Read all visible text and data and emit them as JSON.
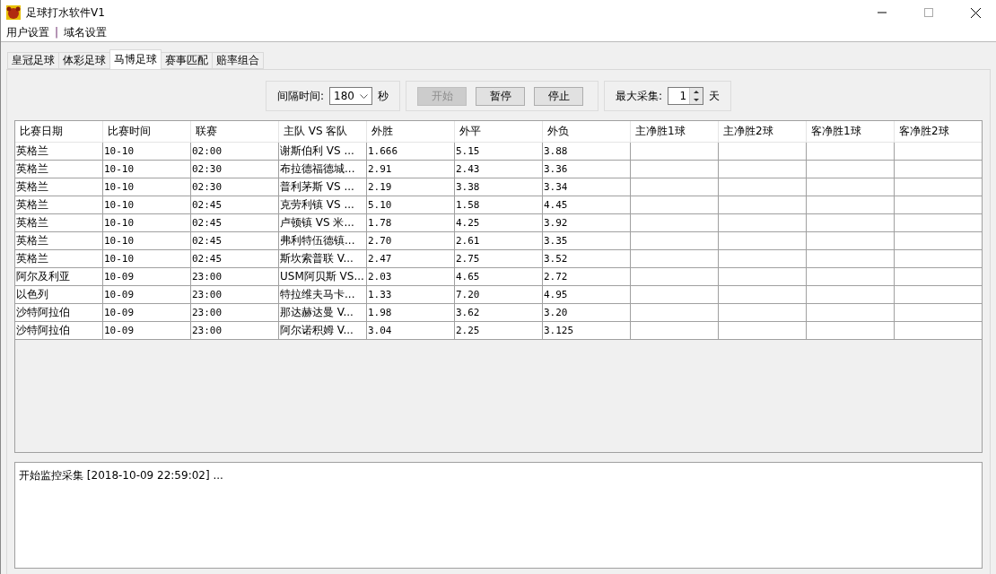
{
  "window": {
    "title": "足球打水软件V1"
  },
  "menu": [
    {
      "label": "用户设置"
    },
    {
      "label": "|",
      "kind": "separator"
    },
    {
      "label": "域名设置"
    }
  ],
  "tabs": [
    {
      "label": "皇冠足球",
      "selected": false
    },
    {
      "label": "体彩足球",
      "selected": false
    },
    {
      "label": "马博足球",
      "selected": true
    },
    {
      "label": "赛事匹配",
      "selected": false
    },
    {
      "label": "赔率组合",
      "selected": false
    }
  ],
  "interval": {
    "label": "间隔时间:",
    "value": "180",
    "unit": "秒"
  },
  "buttons": [
    {
      "label": "开始",
      "disabled": true
    },
    {
      "label": "暂停",
      "disabled": false
    },
    {
      "label": "停止",
      "disabled": false
    }
  ],
  "max_collect": {
    "label": "最大采集:",
    "value": "1",
    "unit": "天"
  },
  "table": {
    "columns": [
      "比赛日期",
      "比赛时间",
      "联赛",
      "主队 VS 客队",
      "外胜",
      "外平",
      "外负",
      "主净胜1球",
      "主净胜2球",
      "客净胜1球",
      "客净胜2球"
    ],
    "rows": [
      [
        "英格兰",
        "10-10",
        "02:00",
        "谢斯伯利 VS ...",
        "1.666",
        "5.15",
        "3.88",
        "",
        "",
        "",
        ""
      ],
      [
        "英格兰",
        "10-10",
        "02:30",
        "布拉德福德城...",
        "2.91",
        "2.43",
        "3.36",
        "",
        "",
        "",
        ""
      ],
      [
        "英格兰",
        "10-10",
        "02:30",
        "普利茅斯 VS ...",
        "2.19",
        "3.38",
        "3.34",
        "",
        "",
        "",
        ""
      ],
      [
        "英格兰",
        "10-10",
        "02:45",
        "克劳利镇 VS ...",
        "5.10",
        "1.58",
        "4.45",
        "",
        "",
        "",
        ""
      ],
      [
        "英格兰",
        "10-10",
        "02:45",
        "卢顿镇 VS 米...",
        "1.78",
        "4.25",
        "3.92",
        "",
        "",
        "",
        ""
      ],
      [
        "英格兰",
        "10-10",
        "02:45",
        "弗利特伍德镇...",
        "2.70",
        "2.61",
        "3.35",
        "",
        "",
        "",
        ""
      ],
      [
        "英格兰",
        "10-10",
        "02:45",
        "斯坎索普联 V...",
        "2.47",
        "2.75",
        "3.52",
        "",
        "",
        "",
        ""
      ],
      [
        "阿尔及利亚",
        "10-09",
        "23:00",
        "USM阿贝斯 VS...",
        "2.03",
        "4.65",
        "2.72",
        "",
        "",
        "",
        ""
      ],
      [
        "以色列",
        "10-09",
        "23:00",
        "特拉维夫马卡...",
        "1.33",
        "7.20",
        "4.95",
        "",
        "",
        "",
        ""
      ],
      [
        "沙特阿拉伯",
        "10-09",
        "23:00",
        "那达赫达曼 V...",
        "1.98",
        "3.62",
        "3.20",
        "",
        "",
        "",
        ""
      ],
      [
        "沙特阿拉伯",
        "10-09",
        "23:00",
        "阿尔诺积姆 V...",
        "3.04",
        "2.25",
        "3.125",
        "",
        "",
        "",
        ""
      ]
    ]
  },
  "log": [
    "开始监控采集 [2018-10-09 22:59:02] ..."
  ]
}
